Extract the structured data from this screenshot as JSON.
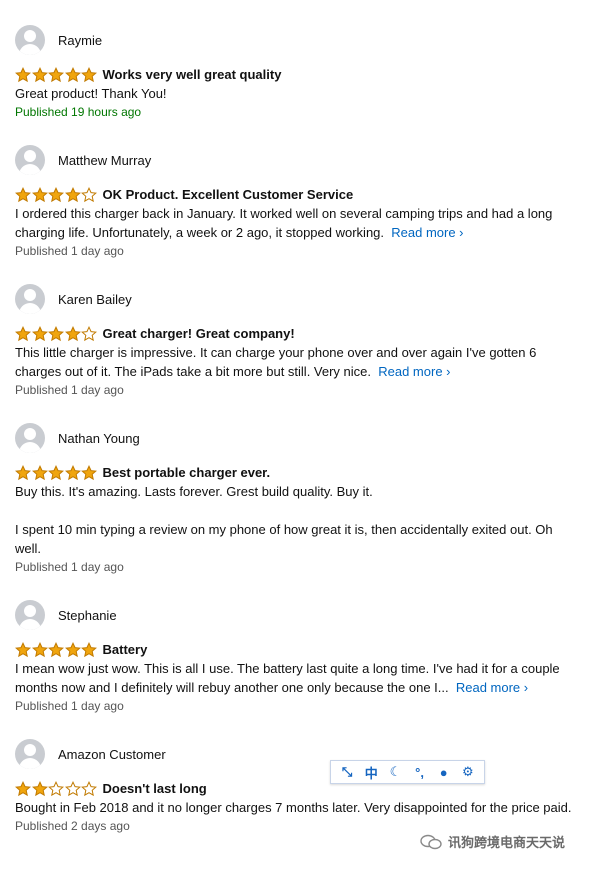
{
  "reviews": [
    {
      "name": "Raymie",
      "rating": 5,
      "title": "Works very well great quality",
      "body": [
        "Great product! Thank You!"
      ],
      "read_more": "",
      "published": "Published 19 hours ago",
      "recent": true
    },
    {
      "name": "Matthew Murray",
      "rating": 4,
      "title": "OK Product. Excellent Customer Service",
      "body": [
        "I ordered this charger back in January. It worked well on several camping trips and had a long",
        "charging life. Unfortunately, a week or 2 ago, it stopped working."
      ],
      "read_more": "Read more ›",
      "published": "Published 1 day ago",
      "recent": false
    },
    {
      "name": "Karen Bailey",
      "rating": 4,
      "title": "Great charger! Great company!",
      "body": [
        "This little charger is impressive. It can charge your phone over and over again I've gotten 6",
        "charges out of it. The iPads take a bit more but still. Very nice."
      ],
      "read_more": "Read more ›",
      "published": "Published 1 day ago",
      "recent": false
    },
    {
      "name": "Nathan Young",
      "rating": 5,
      "title": "Best portable charger ever.",
      "body": [
        "Buy this. It's amazing. Lasts forever. Grest build quality. Buy it.",
        "",
        "I spent 10 min typing a review on my phone of how great it is, then accidentally exited out. Oh",
        "well."
      ],
      "read_more": "",
      "published": "Published 1 day ago",
      "recent": false
    },
    {
      "name": "Stephanie",
      "rating": 5,
      "title": "Battery",
      "body": [
        "I mean wow just wow. This is all I use. The battery last quite a long time. I've had it for a couple",
        "months now and I definitely will rebuy another one only because the one I..."
      ],
      "read_more": "Read more ›",
      "published": "Published 1 day ago",
      "recent": false
    },
    {
      "name": "Amazon Customer",
      "rating": 2,
      "title": "Doesn't last long",
      "body": [
        "Bought in Feb 2018 and it no longer charges 7 months later. Very disappointed for the price paid."
      ],
      "read_more": "",
      "published": "Published 2 days ago",
      "recent": false
    }
  ],
  "colors": {
    "star_fill": "#f0a50e",
    "star_stroke": "#c17a00",
    "star_empty": "#ffffff",
    "link": "#0066c0",
    "recent": "#007600"
  },
  "toolbar": {
    "items": [
      {
        "icon": "arrow-icon",
        "glyph": "⤡"
      },
      {
        "icon": "chinese-mode-icon",
        "glyph": "中"
      },
      {
        "icon": "moon-icon",
        "glyph": "☾"
      },
      {
        "icon": "punctuation-icon",
        "glyph": "°,"
      },
      {
        "icon": "user-icon",
        "glyph": "●"
      },
      {
        "icon": "gear-icon",
        "glyph": "⚙"
      }
    ]
  },
  "watermark": {
    "text": "讯狗跨境电商天天说"
  }
}
